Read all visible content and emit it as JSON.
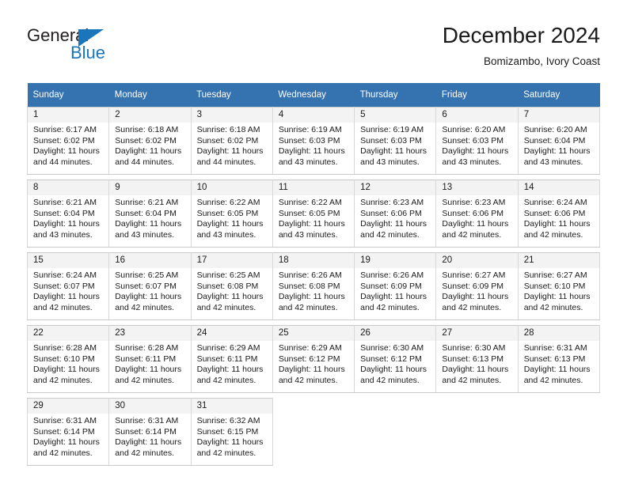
{
  "logo": {
    "text_primary": "General",
    "text_secondary": "Blue",
    "triangle_icon": "triangle-icon",
    "color_primary": "#231f20",
    "color_secondary": "#1b75bb"
  },
  "header": {
    "title": "December 2024",
    "subtitle": "Bomizambo, Ivory Coast"
  },
  "theme": {
    "header_bg": "#3572b0",
    "header_text": "#ffffff",
    "daynum_bg": "#f3f3f3",
    "cell_border": "#c9c9c9"
  },
  "weekday_headers": [
    "Sunday",
    "Monday",
    "Tuesday",
    "Wednesday",
    "Thursday",
    "Friday",
    "Saturday"
  ],
  "weeks": [
    [
      {
        "day": "1",
        "sunrise": "Sunrise: 6:17 AM",
        "sunset": "Sunset: 6:02 PM",
        "daylight1": "Daylight: 11 hours",
        "daylight2": "and 44 minutes."
      },
      {
        "day": "2",
        "sunrise": "Sunrise: 6:18 AM",
        "sunset": "Sunset: 6:02 PM",
        "daylight1": "Daylight: 11 hours",
        "daylight2": "and 44 minutes."
      },
      {
        "day": "3",
        "sunrise": "Sunrise: 6:18 AM",
        "sunset": "Sunset: 6:02 PM",
        "daylight1": "Daylight: 11 hours",
        "daylight2": "and 44 minutes."
      },
      {
        "day": "4",
        "sunrise": "Sunrise: 6:19 AM",
        "sunset": "Sunset: 6:03 PM",
        "daylight1": "Daylight: 11 hours",
        "daylight2": "and 43 minutes."
      },
      {
        "day": "5",
        "sunrise": "Sunrise: 6:19 AM",
        "sunset": "Sunset: 6:03 PM",
        "daylight1": "Daylight: 11 hours",
        "daylight2": "and 43 minutes."
      },
      {
        "day": "6",
        "sunrise": "Sunrise: 6:20 AM",
        "sunset": "Sunset: 6:03 PM",
        "daylight1": "Daylight: 11 hours",
        "daylight2": "and 43 minutes."
      },
      {
        "day": "7",
        "sunrise": "Sunrise: 6:20 AM",
        "sunset": "Sunset: 6:04 PM",
        "daylight1": "Daylight: 11 hours",
        "daylight2": "and 43 minutes."
      }
    ],
    [
      {
        "day": "8",
        "sunrise": "Sunrise: 6:21 AM",
        "sunset": "Sunset: 6:04 PM",
        "daylight1": "Daylight: 11 hours",
        "daylight2": "and 43 minutes."
      },
      {
        "day": "9",
        "sunrise": "Sunrise: 6:21 AM",
        "sunset": "Sunset: 6:04 PM",
        "daylight1": "Daylight: 11 hours",
        "daylight2": "and 43 minutes."
      },
      {
        "day": "10",
        "sunrise": "Sunrise: 6:22 AM",
        "sunset": "Sunset: 6:05 PM",
        "daylight1": "Daylight: 11 hours",
        "daylight2": "and 43 minutes."
      },
      {
        "day": "11",
        "sunrise": "Sunrise: 6:22 AM",
        "sunset": "Sunset: 6:05 PM",
        "daylight1": "Daylight: 11 hours",
        "daylight2": "and 43 minutes."
      },
      {
        "day": "12",
        "sunrise": "Sunrise: 6:23 AM",
        "sunset": "Sunset: 6:06 PM",
        "daylight1": "Daylight: 11 hours",
        "daylight2": "and 42 minutes."
      },
      {
        "day": "13",
        "sunrise": "Sunrise: 6:23 AM",
        "sunset": "Sunset: 6:06 PM",
        "daylight1": "Daylight: 11 hours",
        "daylight2": "and 42 minutes."
      },
      {
        "day": "14",
        "sunrise": "Sunrise: 6:24 AM",
        "sunset": "Sunset: 6:06 PM",
        "daylight1": "Daylight: 11 hours",
        "daylight2": "and 42 minutes."
      }
    ],
    [
      {
        "day": "15",
        "sunrise": "Sunrise: 6:24 AM",
        "sunset": "Sunset: 6:07 PM",
        "daylight1": "Daylight: 11 hours",
        "daylight2": "and 42 minutes."
      },
      {
        "day": "16",
        "sunrise": "Sunrise: 6:25 AM",
        "sunset": "Sunset: 6:07 PM",
        "daylight1": "Daylight: 11 hours",
        "daylight2": "and 42 minutes."
      },
      {
        "day": "17",
        "sunrise": "Sunrise: 6:25 AM",
        "sunset": "Sunset: 6:08 PM",
        "daylight1": "Daylight: 11 hours",
        "daylight2": "and 42 minutes."
      },
      {
        "day": "18",
        "sunrise": "Sunrise: 6:26 AM",
        "sunset": "Sunset: 6:08 PM",
        "daylight1": "Daylight: 11 hours",
        "daylight2": "and 42 minutes."
      },
      {
        "day": "19",
        "sunrise": "Sunrise: 6:26 AM",
        "sunset": "Sunset: 6:09 PM",
        "daylight1": "Daylight: 11 hours",
        "daylight2": "and 42 minutes."
      },
      {
        "day": "20",
        "sunrise": "Sunrise: 6:27 AM",
        "sunset": "Sunset: 6:09 PM",
        "daylight1": "Daylight: 11 hours",
        "daylight2": "and 42 minutes."
      },
      {
        "day": "21",
        "sunrise": "Sunrise: 6:27 AM",
        "sunset": "Sunset: 6:10 PM",
        "daylight1": "Daylight: 11 hours",
        "daylight2": "and 42 minutes."
      }
    ],
    [
      {
        "day": "22",
        "sunrise": "Sunrise: 6:28 AM",
        "sunset": "Sunset: 6:10 PM",
        "daylight1": "Daylight: 11 hours",
        "daylight2": "and 42 minutes."
      },
      {
        "day": "23",
        "sunrise": "Sunrise: 6:28 AM",
        "sunset": "Sunset: 6:11 PM",
        "daylight1": "Daylight: 11 hours",
        "daylight2": "and 42 minutes."
      },
      {
        "day": "24",
        "sunrise": "Sunrise: 6:29 AM",
        "sunset": "Sunset: 6:11 PM",
        "daylight1": "Daylight: 11 hours",
        "daylight2": "and 42 minutes."
      },
      {
        "day": "25",
        "sunrise": "Sunrise: 6:29 AM",
        "sunset": "Sunset: 6:12 PM",
        "daylight1": "Daylight: 11 hours",
        "daylight2": "and 42 minutes."
      },
      {
        "day": "26",
        "sunrise": "Sunrise: 6:30 AM",
        "sunset": "Sunset: 6:12 PM",
        "daylight1": "Daylight: 11 hours",
        "daylight2": "and 42 minutes."
      },
      {
        "day": "27",
        "sunrise": "Sunrise: 6:30 AM",
        "sunset": "Sunset: 6:13 PM",
        "daylight1": "Daylight: 11 hours",
        "daylight2": "and 42 minutes."
      },
      {
        "day": "28",
        "sunrise": "Sunrise: 6:31 AM",
        "sunset": "Sunset: 6:13 PM",
        "daylight1": "Daylight: 11 hours",
        "daylight2": "and 42 minutes."
      }
    ],
    [
      {
        "day": "29",
        "sunrise": "Sunrise: 6:31 AM",
        "sunset": "Sunset: 6:14 PM",
        "daylight1": "Daylight: 11 hours",
        "daylight2": "and 42 minutes."
      },
      {
        "day": "30",
        "sunrise": "Sunrise: 6:31 AM",
        "sunset": "Sunset: 6:14 PM",
        "daylight1": "Daylight: 11 hours",
        "daylight2": "and 42 minutes."
      },
      {
        "day": "31",
        "sunrise": "Sunrise: 6:32 AM",
        "sunset": "Sunset: 6:15 PM",
        "daylight1": "Daylight: 11 hours",
        "daylight2": "and 42 minutes."
      },
      null,
      null,
      null,
      null
    ]
  ]
}
